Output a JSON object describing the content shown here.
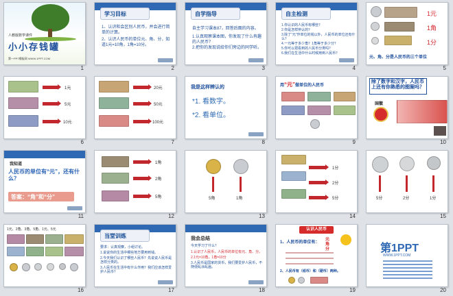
{
  "slides": [
    {
      "num": "1",
      "school": "人教版数学课件",
      "title": "小小存钱罐",
      "footer": "第一PPT模板网 WWW.1PPT.COM"
    },
    {
      "num": "2",
      "heading": "学习目标",
      "lines": [
        "1、认识和会区别人民币，并会进行简单的计算。",
        "2、认识人民币的单位元、角、分，知道1元=10角，1角=10分。"
      ]
    },
    {
      "num": "3",
      "heading": "自学指导",
      "lines": [
        "自主学习课本87，回答后面的内容。",
        "1.认真观察课本图，你发现了什么有趣的人民币？",
        "2.把你的发现说给你们旁边的同学听。"
      ]
    },
    {
      "num": "4",
      "heading": "自主检测",
      "lines": [
        "1.你认识的人民币有哪些？",
        "2.你是怎样辨认的？",
        "3.除了“元”作单位的钱以外，人民币的单位还有什么？",
        "4.一元等于多少角？1角等于多少分？",
        "5.你可以把看到的人民币分类吗？",
        "6.我们在生活中什么时候用到人民币？"
      ]
    },
    {
      "num": "5",
      "labels": [
        "1元",
        "1角",
        "1分"
      ],
      "caption": "元、角、分是人民币的三个单位"
    },
    {
      "num": "6",
      "labels": [
        "1元",
        "5元",
        "10元"
      ]
    },
    {
      "num": "7",
      "labels": [
        "20元",
        "50元",
        "100元"
      ]
    },
    {
      "num": "8",
      "heading": "我是这样辨认的",
      "items": [
        "*1. 看数字。",
        "*2. 看单位。"
      ]
    },
    {
      "num": "9",
      "heading_prefix": "用",
      "heading_red": "“元”",
      "heading_suffix": "做单位的人民币"
    },
    {
      "num": "10",
      "callout": "除了数字和汉字，人民币上还有你熟悉的图案吗？",
      "label": "国徽"
    },
    {
      "num": "11",
      "small": "我知道",
      "question": "人民币的单位有“元”，还有什么？",
      "answer": "答案：“角”和“分”"
    },
    {
      "num": "12",
      "labels": [
        "1角",
        "2角",
        "5角"
      ]
    },
    {
      "num": "13",
      "labels": [
        "5角",
        "1角"
      ]
    },
    {
      "num": "14",
      "labels": [
        "1分",
        "2分",
        "5分"
      ]
    },
    {
      "num": "15",
      "labels": [
        "5分",
        "2分",
        "1分"
      ]
    },
    {
      "num": "16",
      "header": "1元、2角、3角、5角、1元、5元"
    },
    {
      "num": "17",
      "heading": "当堂训练",
      "lines": [
        "要求：认真观察，小组讨论。",
        "1.说说你的生活中哪些地方要用到钱。",
        "2.今天我们认识了哪些人民币？先说说人民币是怎样分类的。",
        "3.人民币在生活中有什么作用？我们应该怎样爱护人民币？"
      ]
    },
    {
      "num": "18",
      "heading": "我会总结",
      "lines": [
        "今天学习了什么？",
        "1.认识了人民币，人民币的单位有元、角、分。",
        "2.1元=10角，1角=10分",
        "3.人民币是国家的货币，我们要爱护人民币，不随便乱涂乱画。"
      ]
    },
    {
      "num": "19",
      "banner": "认识人民币",
      "item1": "1、人民币的单位有：",
      "units": [
        "元",
        "角",
        "分"
      ],
      "item2": "2、人民币有（纸币）和（硬币）两种。"
    },
    {
      "num": "20",
      "logo": "第1PPT",
      "sub": "WWW.1PPT.COM"
    }
  ]
}
